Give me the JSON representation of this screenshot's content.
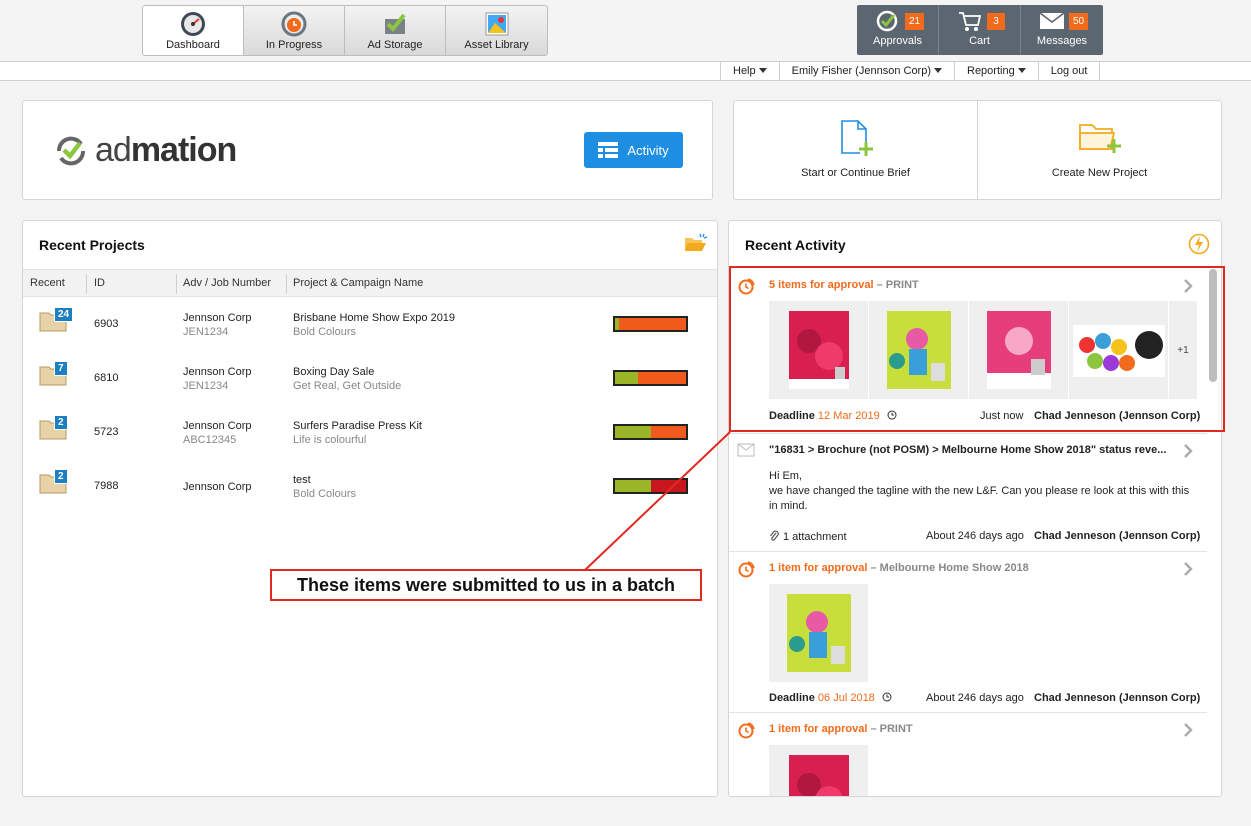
{
  "nav": {
    "tabs": [
      {
        "label": "Dashboard",
        "icon": "speedometer-icon",
        "active": true
      },
      {
        "label": "In Progress",
        "icon": "progress-clock-icon",
        "active": false
      },
      {
        "label": "Ad Storage",
        "icon": "storage-check-icon",
        "active": false
      },
      {
        "label": "Asset Library",
        "icon": "image-library-icon",
        "active": false
      }
    ],
    "right": [
      {
        "label": "Approvals",
        "count": "21",
        "icon": "approvals-icon"
      },
      {
        "label": "Cart",
        "count": "3",
        "icon": "cart-icon"
      },
      {
        "label": "Messages",
        "count": "50",
        "icon": "envelope-icon"
      }
    ],
    "menu": {
      "help": "Help",
      "user": "Emily Fisher (Jennson Corp)",
      "reporting": "Reporting",
      "logout": "Log out"
    }
  },
  "brand": {
    "name_light": "ad",
    "name_bold": "mation",
    "activity_button": "Activity"
  },
  "actions": {
    "brief": "Start or Continue Brief",
    "project": "Create New Project"
  },
  "projects": {
    "title": "Recent Projects",
    "columns": {
      "recent": "Recent",
      "id": "ID",
      "adv": "Adv / Job Number",
      "name": "Project & Campaign Name"
    },
    "rows": [
      {
        "count": "24",
        "id": "6903",
        "adv": "Jennson Corp",
        "job": "JEN1234",
        "project": "Brisbane Home Show Expo 2019",
        "campaign": "Bold Colours",
        "progress": [
          0.06,
          0,
          0.94
        ],
        "colors": [
          "#9ab528",
          "#9ab528",
          "#f05a1a"
        ]
      },
      {
        "count": "7",
        "id": "6810",
        "adv": "Jennson Corp",
        "job": "JEN1234",
        "project": "Boxing Day Sale",
        "campaign": "Get Real, Get Outside",
        "progress": [
          0.33,
          0,
          0.67
        ],
        "colors": [
          "#9ab528",
          "#9ab528",
          "#f05a1a"
        ]
      },
      {
        "count": "2",
        "id": "5723",
        "adv": "Jennson Corp",
        "job": "ABC12345",
        "project": "Surfers Paradise Press Kit",
        "campaign": "Life is colourful",
        "progress": [
          0.5,
          0,
          0.5
        ],
        "colors": [
          "#9ab528",
          "#9ab528",
          "#f05a1a"
        ]
      },
      {
        "count": "2",
        "id": "7988",
        "adv": "Jennson Corp",
        "job": "",
        "project": "test",
        "campaign": "Bold Colours",
        "progress": [
          0.5,
          0,
          0.5
        ],
        "colors": [
          "#9ab528",
          "#9ab528",
          "#c8171e"
        ]
      }
    ]
  },
  "activity": {
    "title": "Recent Activity",
    "items": [
      {
        "head": "5 items for approval",
        "suffix": " – PRINT",
        "deadline_label": "Deadline",
        "deadline": "12 Mar 2019",
        "when": "Just now",
        "who": "Chad Jenneson (Jennson Corp)",
        "more": "+1"
      },
      {
        "title": "\"16831 > Brochure (not POSM) > Melbourne Home Show 2018\" status reve...",
        "body": "Hi Em,\nwe have changed the tagline with the new L&F.  Can you please re look at this with this in mind.",
        "attachment": "1 attachment",
        "when": "About 246 days ago",
        "who": "Chad Jenneson (Jennson Corp)"
      },
      {
        "head": "1 item for approval",
        "suffix": " – Melbourne Home Show 2018",
        "deadline_label": "Deadline",
        "deadline": "06 Jul 2018",
        "when": "About 246 days ago",
        "who": "Chad Jenneson (Jennson Corp)"
      },
      {
        "head": "1 item for approval",
        "suffix": " – PRINT"
      }
    ]
  },
  "annotation": {
    "text": "These items were submitted to us in a batch"
  },
  "colors": {
    "accent_orange": "#f26a1b",
    "button_blue": "#1e8ee3",
    "annotation_red": "#e02a20",
    "nav_dark": "#5c6670"
  }
}
